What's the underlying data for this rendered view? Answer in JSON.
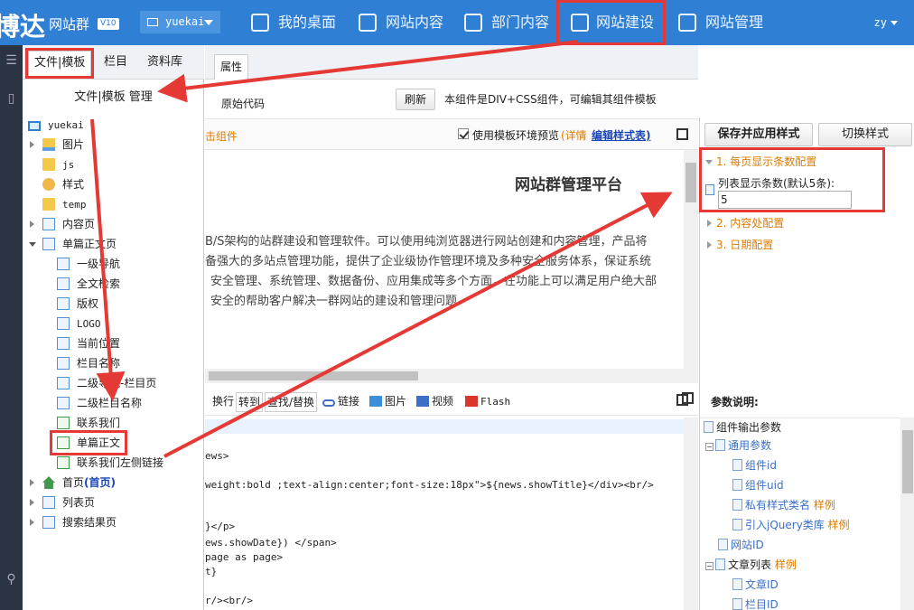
{
  "topbar": {
    "brand": "博达",
    "brand_sub": "网站群",
    "version": "V10",
    "site": "yuekai",
    "user": "zy",
    "nav": [
      {
        "label": "我的桌面"
      },
      {
        "label": "网站内容"
      },
      {
        "label": "部门内容"
      },
      {
        "label": "网站建设"
      },
      {
        "label": "网站管理"
      }
    ]
  },
  "left": {
    "tabs": [
      "文件|模板",
      "栏目",
      "资料库"
    ],
    "heading": "文件|模板 管理",
    "tree": {
      "root": "yuekai",
      "images": "图片",
      "js": "js",
      "style": "样式",
      "temp": "temp",
      "content_page": "内容页",
      "single_page": "单篇正文页",
      "children": [
        "一级导航",
        "全文检索",
        "版权",
        "LOGO",
        "当前位置",
        "栏目名称",
        "二级导航-栏目页",
        "二级栏目名称",
        "联系我们",
        "单篇正文",
        "联系我们左侧链接"
      ],
      "home": "首页",
      "home_tag": "(首页)",
      "list_page": "列表页",
      "search_page": "搜索结果页"
    }
  },
  "center": {
    "tab": "属性",
    "code_label": "原始代码",
    "refresh": "刷新",
    "desc": "本组件是DIV+CSS组件，可编辑其组件模板",
    "click_comp": "击组件",
    "preview_check": "使用模板环境预览",
    "detail": "(详情",
    "edit_style": "编辑样式表)",
    "preview_title": "网站群管理平台",
    "preview_lines": [
      "B/S架构的站群建设和管理软件。可以使用纯浏览器进行网站创建和内容管理，产品将",
      "备强大的多站点管理功能，提供了企业级协作管理环境及多种安全服务体系，保证系统",
      "安全管理、系统管理、数据备份、应用集成等多个方面，在功能上可以满足用户绝大部",
      "安全的帮助客户解决一群网站的建设和管理问题"
    ],
    "tools": [
      "换行",
      "转到",
      "查找/替换",
      "链接",
      "图片",
      "视频",
      "Flash"
    ],
    "code_lines": [
      "",
      "ews>",
      "",
      "weight:bold ;text-align:center;font-size:18px\">${news.showTitle}</div><br/>",
      "",
      "",
      "}</p>",
      "ews.showDate}) </span>",
      "page as page>",
      "t}",
      "",
      "r/><br/>"
    ]
  },
  "right": {
    "save_btn": "保存并应用样式",
    "switch_btn": "切换样式",
    "sections": [
      {
        "num": "1.",
        "title": "每页显示条数配置"
      },
      {
        "num": "2.",
        "title": "内容处配置"
      },
      {
        "num": "3.",
        "title": "日期配置"
      }
    ],
    "cfg_label": "列表显示条数(默认5条):",
    "cfg_value": "5",
    "params_head": "参数说明:",
    "params": {
      "output": "组件输出参数",
      "common": "通用参数",
      "comp_id": "组件id",
      "comp_uid": "组件uid",
      "private_style": "私有样式类名",
      "sample1": "样例",
      "jquery": "引入jQuery类库",
      "sample2": "样例",
      "site_id": "网站ID",
      "article_list": "文章列表",
      "sample3": "样例",
      "article_id": "文章ID",
      "column_id": "栏目ID"
    }
  },
  "colors": {
    "topbar": "#2f80d4",
    "accent": "#e07b00",
    "highlight": "#e53935",
    "link": "#1a46b5"
  }
}
